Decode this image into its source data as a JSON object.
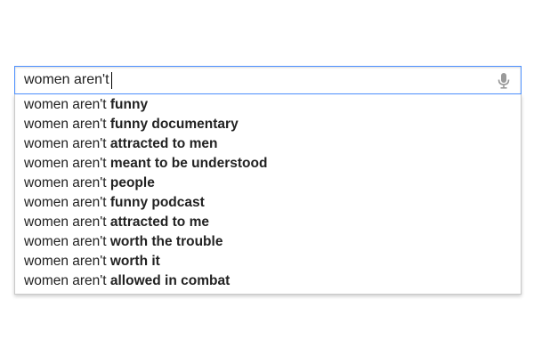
{
  "search": {
    "query": "women aren't",
    "mic_icon": "microphone-icon",
    "suggestions": [
      {
        "prefix": "women aren't ",
        "completion": "funny"
      },
      {
        "prefix": "women aren't ",
        "completion": "funny documentary"
      },
      {
        "prefix": "women aren't ",
        "completion": "attracted to men"
      },
      {
        "prefix": "women aren't ",
        "completion": "meant to be understood"
      },
      {
        "prefix": "women aren't ",
        "completion": "people"
      },
      {
        "prefix": "women aren't ",
        "completion": "funny podcast"
      },
      {
        "prefix": "women aren't ",
        "completion": "attracted to me"
      },
      {
        "prefix": "women aren't ",
        "completion": "worth the trouble"
      },
      {
        "prefix": "women aren't ",
        "completion": "worth it"
      },
      {
        "prefix": "women aren't ",
        "completion": "allowed in combat"
      }
    ]
  },
  "colors": {
    "focus_border": "#4d90fe",
    "dropdown_border": "#c9c9c9",
    "text": "#222222"
  }
}
